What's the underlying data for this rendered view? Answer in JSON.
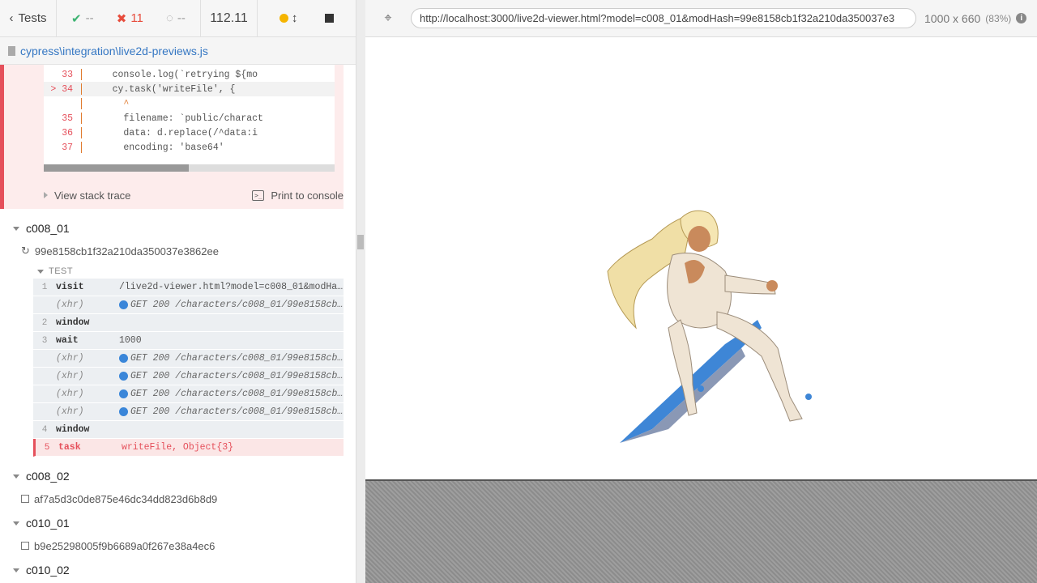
{
  "reporter": {
    "tests_label": "Tests",
    "passed": "--",
    "failed": "11",
    "pending": "--",
    "duration": "112.11",
    "spec_file": "cypress\\integration\\live2d-previews.js"
  },
  "error": {
    "code_lines": [
      {
        "num": "33",
        "text": "    console.log(`retrying ${mo"
      },
      {
        "num": "> 34",
        "text": "    cy.task('writeFile', {"
      },
      {
        "num": "",
        "text": "      ^"
      },
      {
        "num": "35",
        "text": "      filename: `public/charact"
      },
      {
        "num": "36",
        "text": "      data: d.replace(/^data:i"
      },
      {
        "num": "37",
        "text": "      encoding: 'base64'"
      }
    ],
    "view_stack_trace": "View stack trace",
    "print_to_console": "Print to console"
  },
  "suites": [
    {
      "name": "c008_01",
      "test": "99e8158cb1f32a210da350037e3862ee"
    },
    {
      "name": "c008_02",
      "test": "af7a5d3c0de875e46dc34dd823d6b8d9"
    },
    {
      "name": "c010_01",
      "test": "b9e25298005f9b6689a0f267e38a4ec6"
    },
    {
      "name": "c010_02",
      "test": ""
    }
  ],
  "test_label": "TEST",
  "commands": [
    {
      "num": "1",
      "name": "visit",
      "msg": "/live2d-viewer.html?model=c008_01&modHa…",
      "xhr": false
    },
    {
      "num": "",
      "name": "(xhr)",
      "msg": "GET 200 /characters/c008_01/99e8158cb…",
      "xhr": true
    },
    {
      "num": "2",
      "name": "window",
      "msg": "",
      "xhr": false
    },
    {
      "num": "3",
      "name": "wait",
      "msg": "1000",
      "xhr": false
    },
    {
      "num": "",
      "name": "(xhr)",
      "msg": "GET 200 /characters/c008_01/99e8158cb…",
      "xhr": true
    },
    {
      "num": "",
      "name": "(xhr)",
      "msg": "GET 200 /characters/c008_01/99e8158cb…",
      "xhr": true
    },
    {
      "num": "",
      "name": "(xhr)",
      "msg": "GET 200 /characters/c008_01/99e8158cb…",
      "xhr": true
    },
    {
      "num": "",
      "name": "(xhr)",
      "msg": "GET 200 /characters/c008_01/99e8158cb…",
      "xhr": true
    },
    {
      "num": "4",
      "name": "window",
      "msg": "",
      "xhr": false
    },
    {
      "num": "5",
      "name": "task",
      "msg": "writeFile, Object{3}",
      "xhr": false,
      "failed": true
    }
  ],
  "aut": {
    "url": "http://localhost:3000/live2d-viewer.html?model=c008_01&modHash=99e8158cb1f32a210da350037e3",
    "viewport": "1000 x 660",
    "scale": "(83%)"
  }
}
